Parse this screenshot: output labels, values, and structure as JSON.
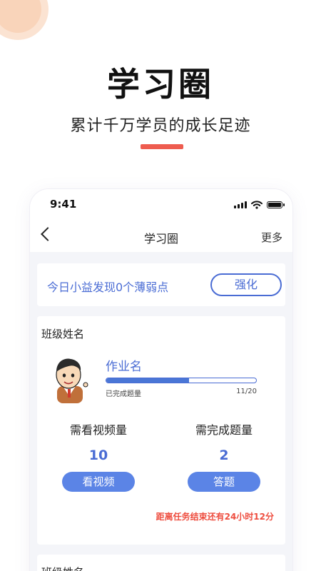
{
  "hero": {
    "title": "学习圈",
    "subtitle": "累计千万学员的成长足迹"
  },
  "status_bar": {
    "time": "9:41"
  },
  "nav": {
    "title": "学习圈",
    "more": "更多"
  },
  "weak_points": {
    "text": "今日小益发现0个薄弱点",
    "button": "强化"
  },
  "class_card": {
    "class_name": "班级姓名",
    "homework_name": "作业名",
    "progress_label": "已完成题量",
    "progress_text": "11/20",
    "progress_fraction": 0.55,
    "video_label": "需看视频量",
    "video_count": "10",
    "video_button": "看视频",
    "questions_label": "需完成题量",
    "questions_count": "2",
    "questions_button": "答题",
    "deadline": "距离任务结束还有24小时12分"
  },
  "next_card": {
    "class_name": "班级姓名"
  },
  "colors": {
    "accent": "#4a6cd4",
    "button": "#5b84e6",
    "alert": "#ee4d3f",
    "hero_bar": "#ee5c4f"
  }
}
